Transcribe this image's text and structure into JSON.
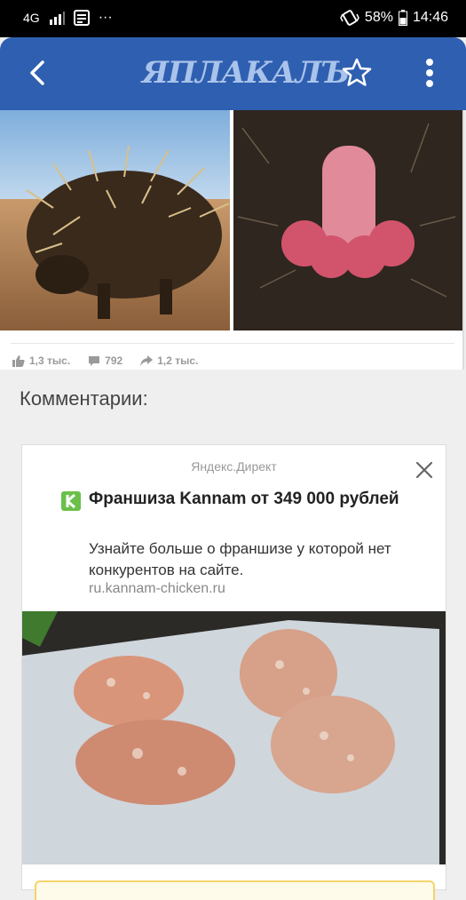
{
  "status_bar": {
    "network": "4G",
    "dots": "···",
    "battery": "58%",
    "time": "14:46"
  },
  "app_bar": {
    "logo_text": "ЯПЛАКАЛЪ",
    "back_icon": "back-arrow-icon",
    "star_icon": "star-outline-icon",
    "more_icon": "more-vertical-icon"
  },
  "post": {
    "stats": {
      "likes": "1,3 тыс.",
      "comments": "792",
      "shares": "1,2 тыс."
    }
  },
  "comments_heading": "Комментарии:",
  "ad": {
    "source": "Яндекс.Директ",
    "title": "Франшиза Kannam от 349 000 рублей",
    "description": "Узнайте больше о франшизе у которой нет конкурентов на сайте.",
    "url": "ru.kannam-chicken.ru"
  },
  "colors": {
    "app_bar": "#2f5fb0",
    "logo": "#a9c3ea",
    "ad_brand_green": "#6bc049"
  }
}
